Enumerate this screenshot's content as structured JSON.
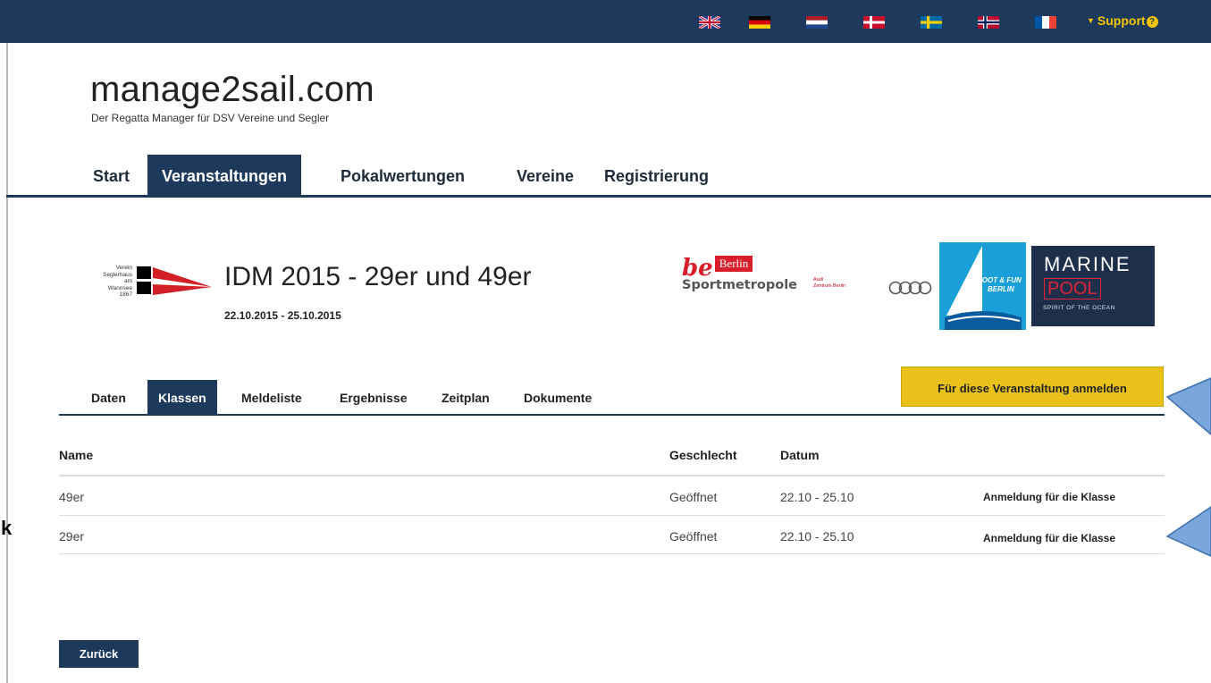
{
  "topbar": {
    "flags": [
      {
        "icon": "uk-flag-icon"
      },
      {
        "icon": "germany-flag-icon"
      },
      {
        "icon": "netherlands-flag-icon"
      },
      {
        "icon": "denmark-flag-icon"
      },
      {
        "icon": "sweden-flag-icon"
      },
      {
        "icon": "norway-flag-icon"
      },
      {
        "icon": "france-flag-icon"
      }
    ],
    "support_label": "Support",
    "support_icon": "question-circle-icon"
  },
  "brand": {
    "title": "manage2sail.com",
    "subtitle": "Der Regatta Manager für DSV Vereine und Segler"
  },
  "main_nav": [
    {
      "label": "Start",
      "active": false
    },
    {
      "label": "Veranstaltungen",
      "active": true
    },
    {
      "label": "Pokalwertungen",
      "active": false
    },
    {
      "label": "Vereine",
      "active": false
    },
    {
      "label": "Registrierung",
      "active": false
    }
  ],
  "club_logo": {
    "lines": [
      "Verein",
      "Seglerhaus",
      "am",
      "Wannsee",
      "1867"
    ]
  },
  "event": {
    "title": "IDM 2015 - 29er und 49er",
    "dates": "22.10.2015 - 25.10.2015"
  },
  "sponsors": {
    "be": "be",
    "berlin": "Berlin",
    "sportmetropole": "Sportmetropole",
    "audi_line1": "Audi",
    "audi_line2": "Zentrum Berlin",
    "boot_line1": "BOOT & FUN",
    "boot_line2": "BERLIN",
    "marine": "MARINE",
    "pool": "POOL",
    "marine_tagline": "SPIRIT OF THE OCEAN"
  },
  "sub_tabs": [
    {
      "label": "Daten",
      "active": false
    },
    {
      "label": "Klassen",
      "active": true
    },
    {
      "label": "Meldeliste",
      "active": false
    },
    {
      "label": "Ergebnisse",
      "active": false
    },
    {
      "label": "Zeitplan",
      "active": false
    },
    {
      "label": "Dokumente",
      "active": false
    }
  ],
  "register_button": "Für diese Veranstaltung anmelden",
  "table": {
    "headers": {
      "name": "Name",
      "geschlecht": "Geschlecht",
      "datum": "Datum"
    },
    "rows": [
      {
        "name": "49er",
        "geschlecht": "Geöffnet",
        "datum": "22.10 - 25.10",
        "action": "Anmeldung für die Klasse"
      },
      {
        "name": "29er",
        "geschlecht": "Geöffnet",
        "datum": "22.10 - 25.10",
        "action": "Anmeldung für die Klasse"
      }
    ]
  },
  "back_button": "Zurück",
  "annotation_text": "k",
  "colors": {
    "navy": "#1d3a5c",
    "yellow": "#e8c11a",
    "callout": "#6b9bd6"
  }
}
